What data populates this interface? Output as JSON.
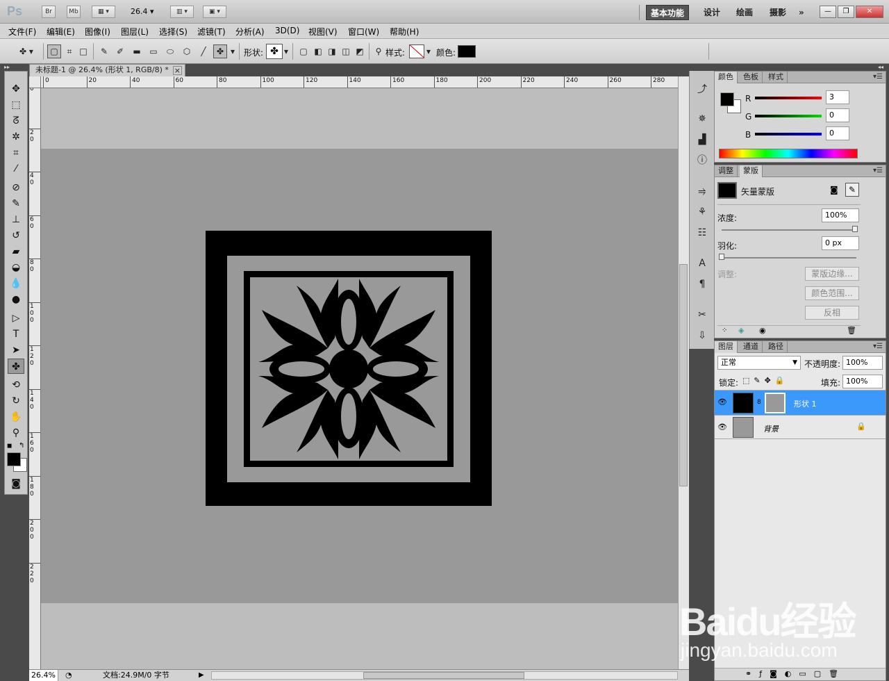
{
  "app": {
    "logo": "Ps",
    "bridge": "Br",
    "minibridge": "Mb",
    "zoom": "26.4"
  },
  "workspaces": [
    "基本功能",
    "设计",
    "绘画",
    "摄影"
  ],
  "menu": [
    "文件(F)",
    "编辑(E)",
    "图像(I)",
    "图层(L)",
    "选择(S)",
    "滤镜(T)",
    "分析(A)",
    "3D(D)",
    "视图(V)",
    "窗口(W)",
    "帮助(H)"
  ],
  "options": {
    "shape_label": "形状:",
    "style_label": "样式:",
    "color_label": "颜色:",
    "color": "#000000"
  },
  "document": {
    "tab_title": "未标题-1 @ 26.4% (形状 1, RGB/8) *",
    "close": "×"
  },
  "ruler_h": [
    "0",
    "20",
    "40",
    "60",
    "80",
    "100",
    "120",
    "140",
    "160",
    "180",
    "200",
    "220",
    "240",
    "260",
    "280"
  ],
  "ruler_v": [
    "0",
    "2\n0",
    "4\n0",
    "6\n0",
    "8\n0",
    "1\n0\n0",
    "1\n2\n0",
    "1\n4\n0",
    "1\n6\n0",
    "1\n8\n0",
    "2\n0\n0",
    "2\n2\n0"
  ],
  "status": {
    "zoom": "26.4%",
    "doc": "文档:24.9M/0 字节"
  },
  "color_panel": {
    "tabs": [
      "颜色",
      "色板",
      "样式"
    ],
    "r_label": "R",
    "g_label": "G",
    "b_label": "B",
    "r": "3",
    "g": "0",
    "b": "0",
    "fg": "#030000",
    "bg": "#ffffff"
  },
  "masks_panel": {
    "tabs": [
      "调整",
      "蒙版"
    ],
    "title": "矢量蒙版",
    "density_label": "浓度:",
    "density": "100%",
    "feather_label": "羽化:",
    "feather": "0 px",
    "refine_label": "调整:",
    "mask_edge": "蒙版边缘...",
    "color_range": "颜色范围...",
    "invert": "反相"
  },
  "layers_panel": {
    "tabs": [
      "图层",
      "通道",
      "路径"
    ],
    "blend_mode": "正常",
    "opacity_label": "不透明度:",
    "opacity": "100%",
    "lock_label": "锁定:",
    "fill_label": "填充:",
    "fill": "100%",
    "layers": [
      {
        "name": "形状 1",
        "selected": true
      },
      {
        "name": "背景",
        "selected": false
      }
    ]
  },
  "watermark": {
    "logo": "Baidu经验",
    "url": "jingyan.baidu.com"
  },
  "colors": {
    "selection": "#3b99fc",
    "canvas_bg": "#bdbdbd",
    "doc_bg": "#999999"
  }
}
